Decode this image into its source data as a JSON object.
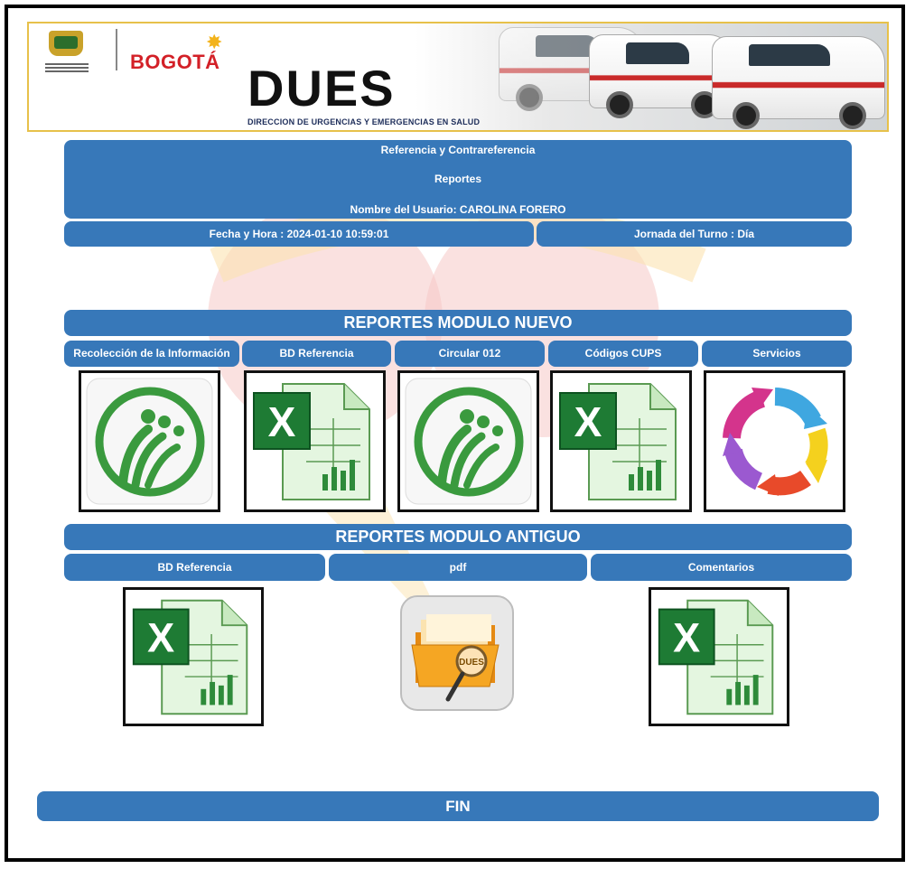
{
  "header": {
    "city": "BOGOTÁ",
    "brand": "DUES",
    "brand_subtitle": "DIRECCION DE URGENCIAS Y EMERGENCIAS EN SALUD"
  },
  "info": {
    "line1": "Referencia y Contrareferencia",
    "line2": "Reportes",
    "line3": "Nombre del Usuario: CAROLINA FORERO",
    "datetime": "Fecha y Hora : 2024-01-10 10:59:01",
    "shift": "Jornada del Turno : Día"
  },
  "new_module": {
    "title": "REPORTES MODULO NUEVO",
    "tabs": [
      "Recolección de la Información",
      "BD Referencia",
      "Circular 012",
      "Códigos CUPS",
      "Servicios"
    ],
    "icons": [
      "app-logo-icon",
      "excel-icon",
      "app-logo-icon",
      "excel-icon",
      "cycle-arrows-icon"
    ]
  },
  "old_module": {
    "title": "REPORTES MODULO ANTIGUO",
    "tabs": [
      "BD Referencia",
      "pdf",
      "Comentarios"
    ],
    "icons": [
      "excel-icon",
      "folder-search-icon",
      "excel-icon"
    ],
    "folder_label": "DUES"
  },
  "footer": {
    "label": "FIN"
  },
  "colors": {
    "bar": "#3778b9",
    "excel_green": "#1e7b34",
    "logo_green": "#3a9a3e"
  }
}
